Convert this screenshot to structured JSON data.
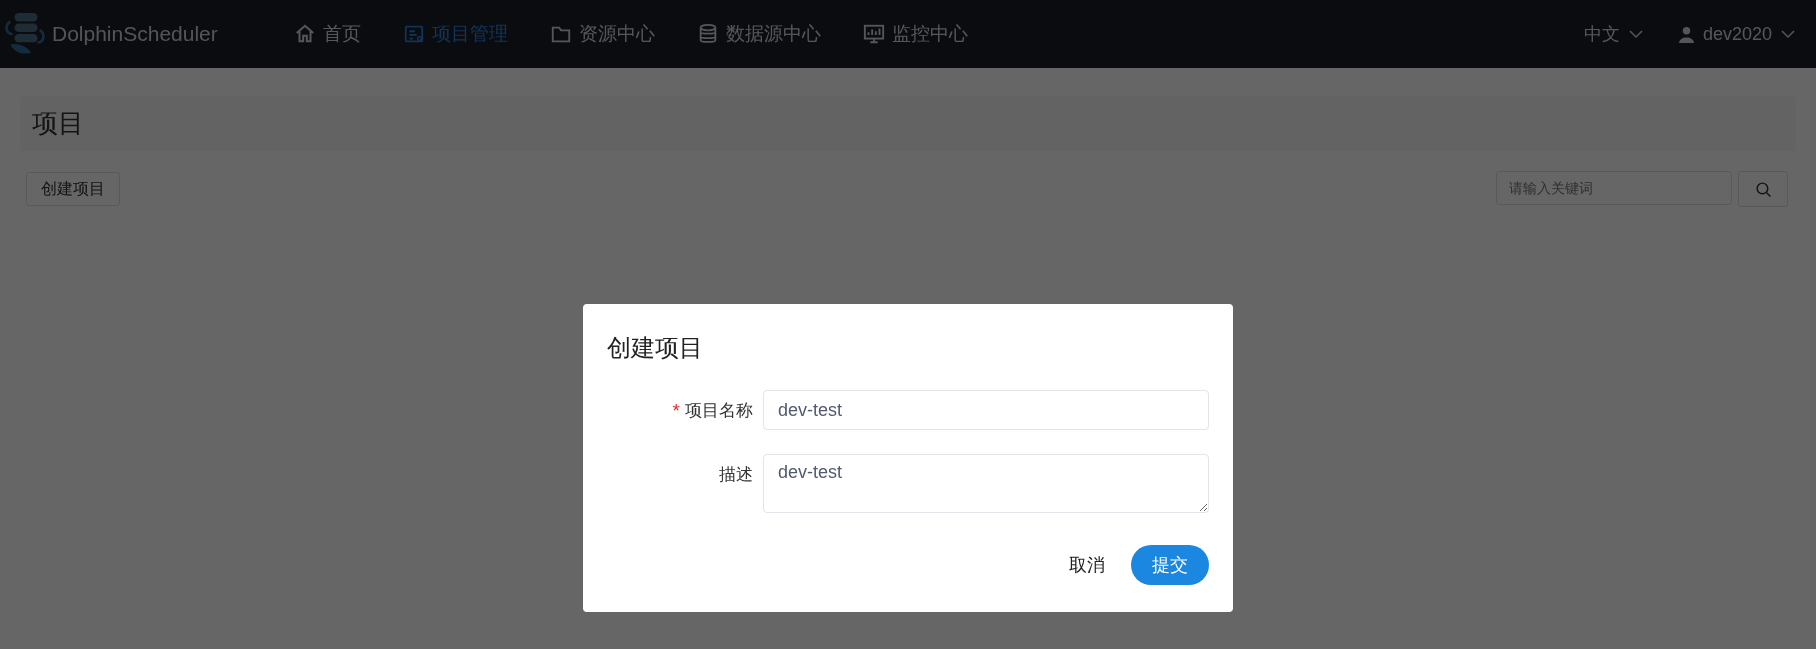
{
  "header": {
    "brand": "DolphinScheduler",
    "nav": [
      {
        "label": "首页",
        "selected": false
      },
      {
        "label": "项目管理",
        "selected": true
      },
      {
        "label": "资源中心",
        "selected": false
      },
      {
        "label": "数据源中心",
        "selected": false
      },
      {
        "label": "监控中心",
        "selected": false
      }
    ],
    "language": "中文",
    "user": "dev2020"
  },
  "page": {
    "title": "项目",
    "create_button": "创建项目",
    "search": {
      "placeholder": "请输入关键词"
    }
  },
  "dialog": {
    "title": "创建项目",
    "fields": [
      {
        "kind": "input",
        "required_mark": "*",
        "label": "项目名称",
        "value": "dev-test"
      },
      {
        "kind": "textarea",
        "label": "描述",
        "value": "dev-test"
      }
    ],
    "buttons": [
      {
        "kind": "text",
        "label": "取消"
      },
      {
        "kind": "primary",
        "label": "提交"
      }
    ]
  }
}
